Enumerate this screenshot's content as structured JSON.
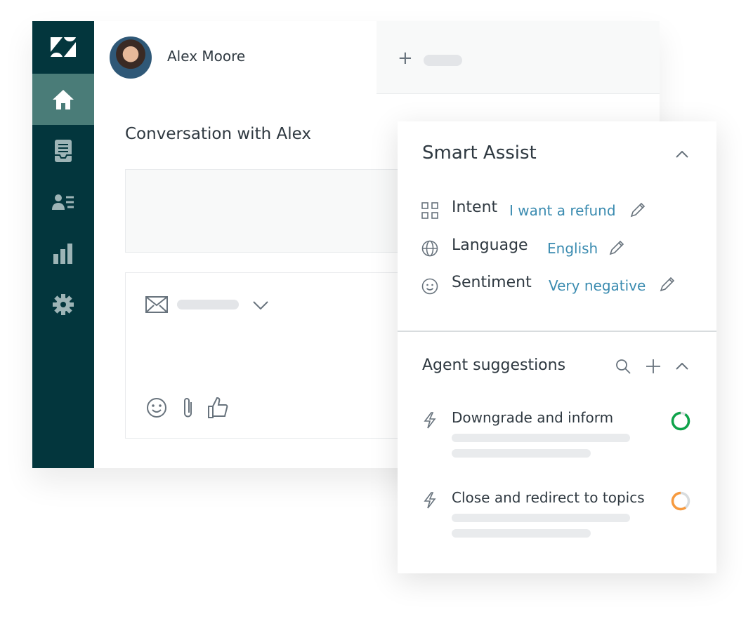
{
  "user": {
    "name": "Alex Moore"
  },
  "conversation": {
    "title": "Conversation with Alex"
  },
  "sidebar": {
    "items": [
      "zendesk-logo",
      "home",
      "tickets",
      "customers",
      "reporting",
      "settings"
    ],
    "active": "home"
  },
  "smart_assist": {
    "title": "Smart Assist",
    "fields": [
      {
        "label": "Intent",
        "value": "I want a refund",
        "icon": "grid-icon"
      },
      {
        "label": "Language",
        "value": "English",
        "icon": "globe-icon"
      },
      {
        "label": "Sentiment",
        "value": "Very negative",
        "icon": "smiley-icon"
      }
    ]
  },
  "agent_suggestions": {
    "title": "Agent suggestions",
    "items": [
      {
        "title": "Downgrade and inform",
        "confidence": 0.9,
        "color": "#0ea34a"
      },
      {
        "title": "Close and redirect to topics",
        "confidence": 0.6,
        "color": "#f79a3e"
      }
    ]
  },
  "colors": {
    "sidebar": "#03363d",
    "active": "#4a7c78",
    "link": "#3a8bb0"
  }
}
